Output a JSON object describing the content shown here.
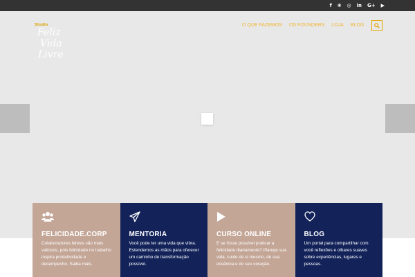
{
  "social": {
    "icons": [
      {
        "name": "facebook-icon",
        "glyph": "f"
      },
      {
        "name": "twitter-icon",
        "glyph": "❀"
      },
      {
        "name": "instagram-icon",
        "glyph": "◎"
      },
      {
        "name": "linkedin-icon",
        "glyph": "in"
      },
      {
        "name": "google-plus-icon",
        "glyph": "G+"
      },
      {
        "name": "youtube-icon",
        "glyph": "▶"
      }
    ]
  },
  "logo": {
    "top": "Studio",
    "line1": "Feliz",
    "line2": "Vida",
    "line3": "Livre"
  },
  "nav": {
    "items": [
      "O QUE FAZEMOS",
      "OS FOUNDERS",
      "LOJA",
      "BLOG"
    ]
  },
  "colors": {
    "tan": "#c4a697",
    "navy": "#13235a",
    "accent": "#e6a700"
  },
  "cards": [
    {
      "title": "FELICIDADE.CORP",
      "text": "Colaboradores felizes são mais valiosos, pois felicidade no trabalho inspira produtividade e desempenho. Saiba mais.",
      "icon": "users-icon"
    },
    {
      "title": "MENTORIA",
      "text": "Você pode ter uma vida que vibra. Estendemos as mãos para oferecer um caminho de transformação possível.",
      "icon": "paper-plane-icon"
    },
    {
      "title": "CURSO ONLINE",
      "text": "E se fosse possível praticar a felicidade diariamente? Planeje sua vida, cuide de si mesmo, de sua essência e do seu coração.",
      "icon": "play-icon"
    },
    {
      "title": "BLOG",
      "text": "Um portal para compartilhar com você reflexões e olhares suaves sobre experiências, lugares e pessoas.",
      "icon": "heart-icon"
    }
  ]
}
